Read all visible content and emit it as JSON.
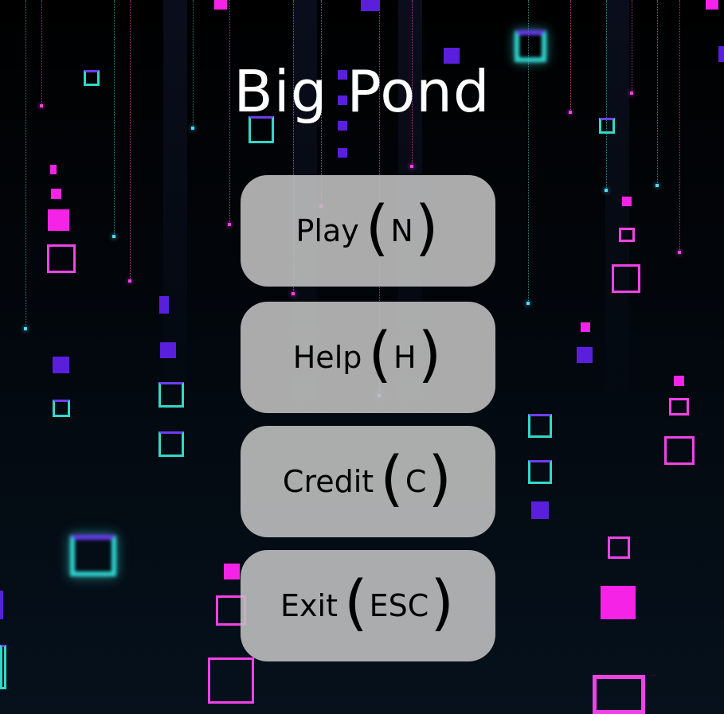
{
  "game": {
    "title": "Big Pond"
  },
  "menu": {
    "items": [
      {
        "label": "Play",
        "open_paren": "(",
        "key": "N",
        "close_paren": ")"
      },
      {
        "label": "Help",
        "open_paren": "(",
        "key": "H",
        "close_paren": ")"
      },
      {
        "label": "Credit",
        "open_paren": "(",
        "key": "C",
        "close_paren": ")"
      },
      {
        "label": "Exit",
        "open_paren": "(",
        "key": "ESC",
        "close_paren": ")"
      }
    ]
  },
  "colors": {
    "background": "#04070d",
    "title": "#ffffff",
    "button_fill": "#bebebe",
    "button_text": "#000000",
    "accent_pink": "#f523e6",
    "accent_violet": "#5a1fdc",
    "accent_teal": "#33d7c8"
  }
}
